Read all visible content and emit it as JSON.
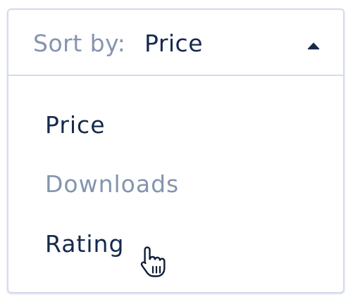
{
  "sort": {
    "label": "Sort by:",
    "selected": "Price",
    "expanded": true,
    "caret_icon": "caret-up-icon"
  },
  "options": [
    {
      "label": "Price",
      "state": "selected"
    },
    {
      "label": "Downloads",
      "state": "muted"
    },
    {
      "label": "Rating",
      "state": "hover"
    }
  ],
  "cursor": {
    "icon": "hand-pointer-icon"
  },
  "colors": {
    "text_dark": "#15294d",
    "text_muted": "#8494ae",
    "border": "#d3dbe8",
    "background": "#ffffff"
  }
}
